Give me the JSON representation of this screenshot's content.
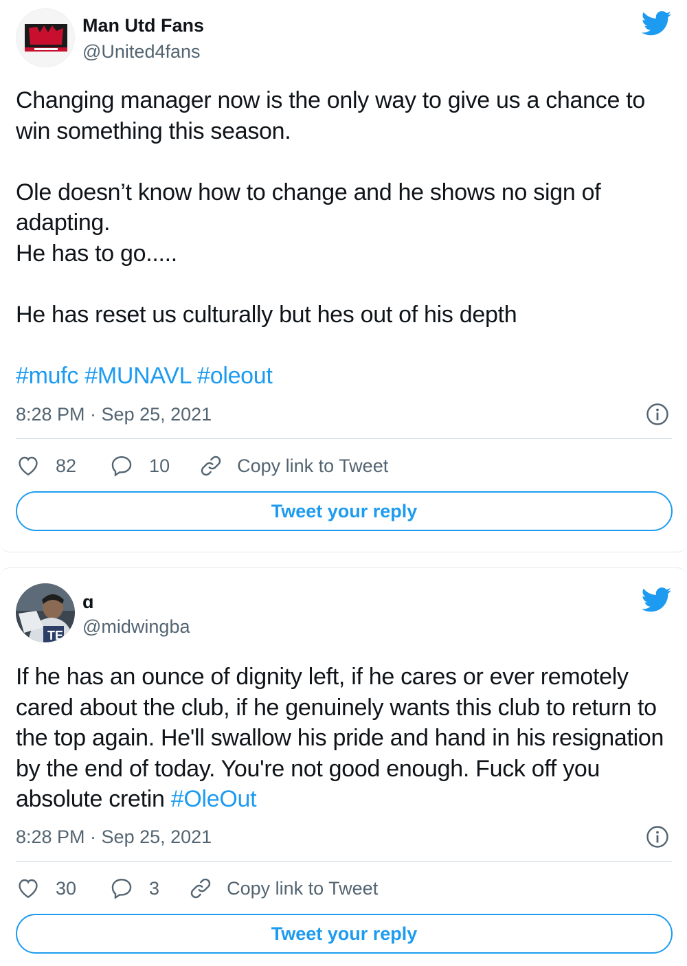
{
  "tweets": [
    {
      "author_name": "Man Utd Fans",
      "author_handle": "@United4fans",
      "text": "Changing manager now is the only way to give us a chance to win something this season.\n\nOle doesn’t know how to change and he shows no sign of adapting.\nHe has to go.....\n\nHe has reset us culturally but hes out of his depth\n\n",
      "hashtags": "#mufc #MUNAVL #oleout",
      "timestamp": "8:28 PM · Sep 25, 2021",
      "likes": "82",
      "replies": "10",
      "copy_link_label": "Copy link to Tweet",
      "reply_button_label": "Tweet your reply"
    },
    {
      "author_name": "ɑ",
      "author_handle": "@midwingba",
      "text": "If he has an ounce of dignity left, if he cares or ever remotely cared about the club, if he genuinely wants this club to return to the top again. He'll swallow his pride and hand in his resignation by the end of today. You're not good enough. Fuck off you absolute cretin ",
      "hashtags": "#OleOut",
      "timestamp": "8:28 PM · Sep 25, 2021",
      "likes": "30",
      "replies": "3",
      "copy_link_label": "Copy link to Tweet",
      "reply_button_label": "Tweet your reply"
    }
  ],
  "icons": {
    "brand": "twitter-bird-icon",
    "like": "heart-icon",
    "reply": "speech-bubble-icon",
    "copy": "link-icon",
    "info": "info-icon"
  },
  "colors": {
    "accent": "#1d9bf0",
    "text": "#0f1419",
    "secondary": "#536471"
  }
}
